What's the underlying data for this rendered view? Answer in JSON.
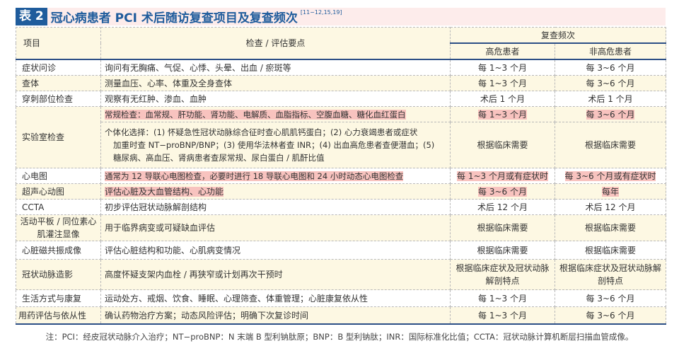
{
  "title": {
    "label": "表 2",
    "text": "冠心病患者 PCI 术后随访复查项目及复查频次",
    "refs": "[11−12,15,19]"
  },
  "header": {
    "item": "项目",
    "points": "检查 / 评估要点",
    "freq": "复查频次",
    "high": "高危患者",
    "nonhigh": "非高危患者"
  },
  "rows": [
    {
      "item": "症状问诊",
      "points": "询问有无胸痛、气促、心悸、头晕、出血 / 瘀斑等",
      "high": "每 1~3 个月",
      "nonhigh": "每 3~6 个月"
    },
    {
      "item": "查体",
      "points": "测量血压、心率、体重及全身查体",
      "high": "每 1~3 个月",
      "nonhigh": "每 3~6 个月"
    },
    {
      "item": "穿刺部位检查",
      "points": "观察有无红肿、渗血、血肿",
      "high": "术后 1 个月",
      "nonhigh": "术后 1 个月"
    },
    {
      "item": "实验室检查",
      "points": "常规检查：血常规、肝功能、肾功能、电解质、血脂指标、空腹血糖、糖化血红蛋白",
      "high": "每 1~3 个月",
      "nonhigh": "每 3~6 个月",
      "points2a": "个体化选择：(1) 怀疑急性冠状动脉综合征时查心肌肌钙蛋白；(2) 心力衰竭患者或症状",
      "points2b": "加重时查 NT−proBNP/BNP；(3) 使用华法林者查 INR；(4) 出血高危患者查便潜血；(5)",
      "points2c": "糖尿病、高血压、肾病患者查尿常规、尿白蛋白 / 肌酐比值",
      "high2": "根据临床需要",
      "nonhigh2": "根据临床需要"
    },
    {
      "item": "心电图",
      "points": "通常为 12 导联心电图检查，必要时进行 18 导联心电图和 24 小时动态心电图检查",
      "high": "每 1~3 个月或有症状时",
      "nonhigh": "每 3~6 个月或有症状时"
    },
    {
      "item": "超声心动图",
      "points": "评估心脏及大血管结构、心功能",
      "high": "每 3~6 个月",
      "nonhigh": "每年"
    },
    {
      "item": "CCTA",
      "points": "初步评估冠状动脉解剖结构",
      "high": "术后 12 个月",
      "nonhigh": "术后 12 个月"
    },
    {
      "item": "活动平板 / 同位素心肌灌注显像",
      "points": "用于临界病变或可疑缺血评估",
      "high": "根据临床需要",
      "nonhigh": "根据临床需要"
    },
    {
      "item": "心脏磁共振成像",
      "points": "评估心脏结构和功能、心肌病变情况",
      "high": "根据临床需要",
      "nonhigh": "根据临床需要"
    },
    {
      "item": "冠状动脉造影",
      "points": "高度怀疑支架内血栓 / 再狭窄或计划再次干预时",
      "high": "根据临床症状及冠状动脉解剖特点",
      "nonhigh": "根据临床症状及冠状动脉解剖特点"
    },
    {
      "item": "生活方式与康复",
      "points": "运动处方、戒烟、饮食、睡眠、心理筛查、体重管理；心脏康复依从性",
      "high": "每 1~3 个月",
      "nonhigh": "每 3~6 个月"
    },
    {
      "item": "用药评估与依从性",
      "points": "确认药物治疗方案；动态风险评估；明确下次复诊时间",
      "high": "每 1~3 个月",
      "nonhigh": "每 3~6 个月"
    }
  ],
  "note": "注：PCI：经皮冠状动脉介入治疗；NT−proBNP：N 末端 B 型利钠肽原；BNP：B 型利钠肽；INR：国际标准化比值；CCTA：冠状动脉计算机断层扫描血管成像。"
}
